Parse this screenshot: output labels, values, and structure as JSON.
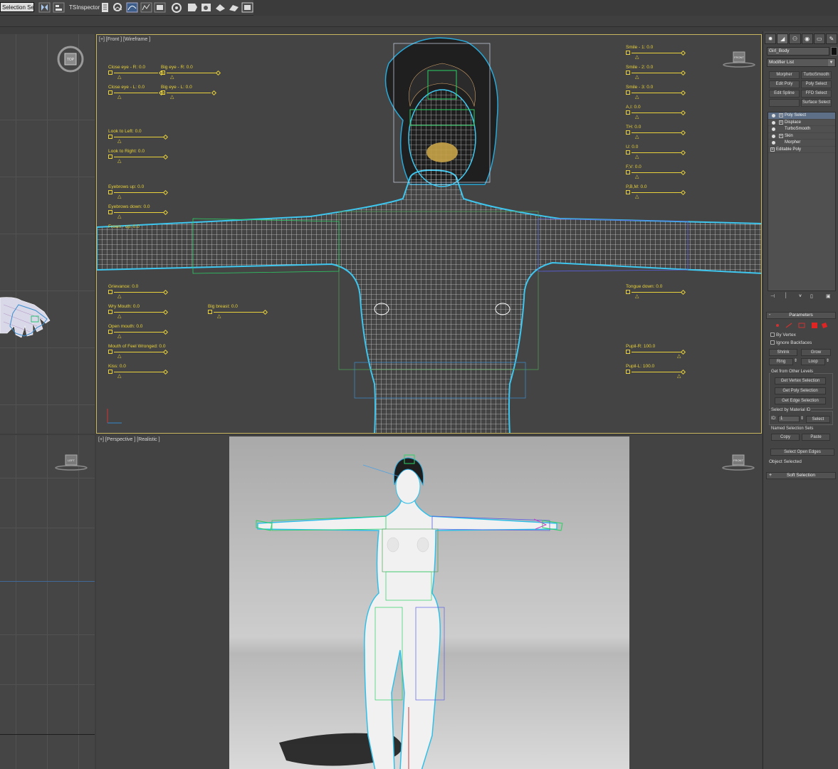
{
  "toolbar": {
    "selection_set": "Selection Se",
    "ts_inspector": "TSInspector"
  },
  "viewports": {
    "front_label": "[+] [Front ] [Wireframe ]",
    "perspective_label": "[+] [Perspective ] [Realistic ]",
    "navcube_top": "TOP",
    "navcube_front": "FRONT",
    "navcube_left": "LEFT"
  },
  "morph_controls": {
    "close_eye_r": "Close eye - R: 0.0",
    "big_eye_r": "Big eye - R: 0.0",
    "close_eye_l": "Close eye - L: 0.0",
    "big_eye_l": "Big eye - L: 0.0",
    "look_left": "Look to Left: 0.0",
    "look_right": "Look to Right: 0.0",
    "eyebrows_up": "Eyebrows up: 0.0",
    "eyebrows_down": "Eyebrows down: 0.0",
    "frown_up": "Frown - up: 0.0",
    "grievance": "Grievance: 0.0",
    "wry_mouth": "Wry Mouth: 0.0",
    "big_breast": "Big breast: 0.0",
    "open_mouth": "Open mouth: 0.0",
    "mouth_wronged": "Mouth of Feel Wronged: 0.0",
    "kiss": "Kiss: 0.0",
    "smile_1": "Smile - 1: 0.0",
    "smile_2": "Smile - 2: 0.0",
    "smile_3": "Smile - 3: 0.0",
    "ai": "A,I: 0.0",
    "th": "TH: 0.0",
    "u": "U: 0.0",
    "fv": "F,V: 0.0",
    "pbm": "P,B,M: 0.0",
    "tongue_down": "Tongue down: 0.0",
    "pupil_r": "Pupil-R: 100.0",
    "pupil_l": "Pupil-L: 100.0"
  },
  "command_panel": {
    "object_name": "Girl_Body",
    "modifier_list": "Modifier List",
    "buttons": {
      "morpher": "Morpher",
      "turbosmooth": "TurboSmooth",
      "edit_poly": "Edit Poly",
      "poly_select": "Poly Select",
      "edit_spline": "Edit Spline",
      "ffd_select": "FFD Select",
      "surface_select": "Surface Select"
    },
    "stack": {
      "poly_select": "Poly Select",
      "displace": "Displace",
      "turbosmooth": "TurboSmooth",
      "skin": "Skin",
      "morpher": "Morpher",
      "editable_poly": "Editable Poly"
    },
    "parameters": {
      "title": "Parameters",
      "by_vertex": "By Vertex",
      "ignore_backfaces": "Ignore Backfaces",
      "shrink": "Shrink",
      "grow": "Grow",
      "ring": "Ring",
      "loop": "Loop",
      "get_from_other_levels": "Get from Other Levels",
      "get_vertex_selection": "Get Vertex Selection",
      "get_poly_selection": "Get Poly Selection",
      "get_edge_selection": "Get Edge Selection",
      "select_by_material_id": "Select by Material ID",
      "id_label": "ID:",
      "id_value": "1",
      "select": "Select",
      "named_selection_sets": "Named Selection Sets",
      "copy": "Copy",
      "paste": "Paste",
      "select_open_edges": "Select Open Edges",
      "status": "Object Selected"
    },
    "soft_selection": "Soft Selection"
  }
}
